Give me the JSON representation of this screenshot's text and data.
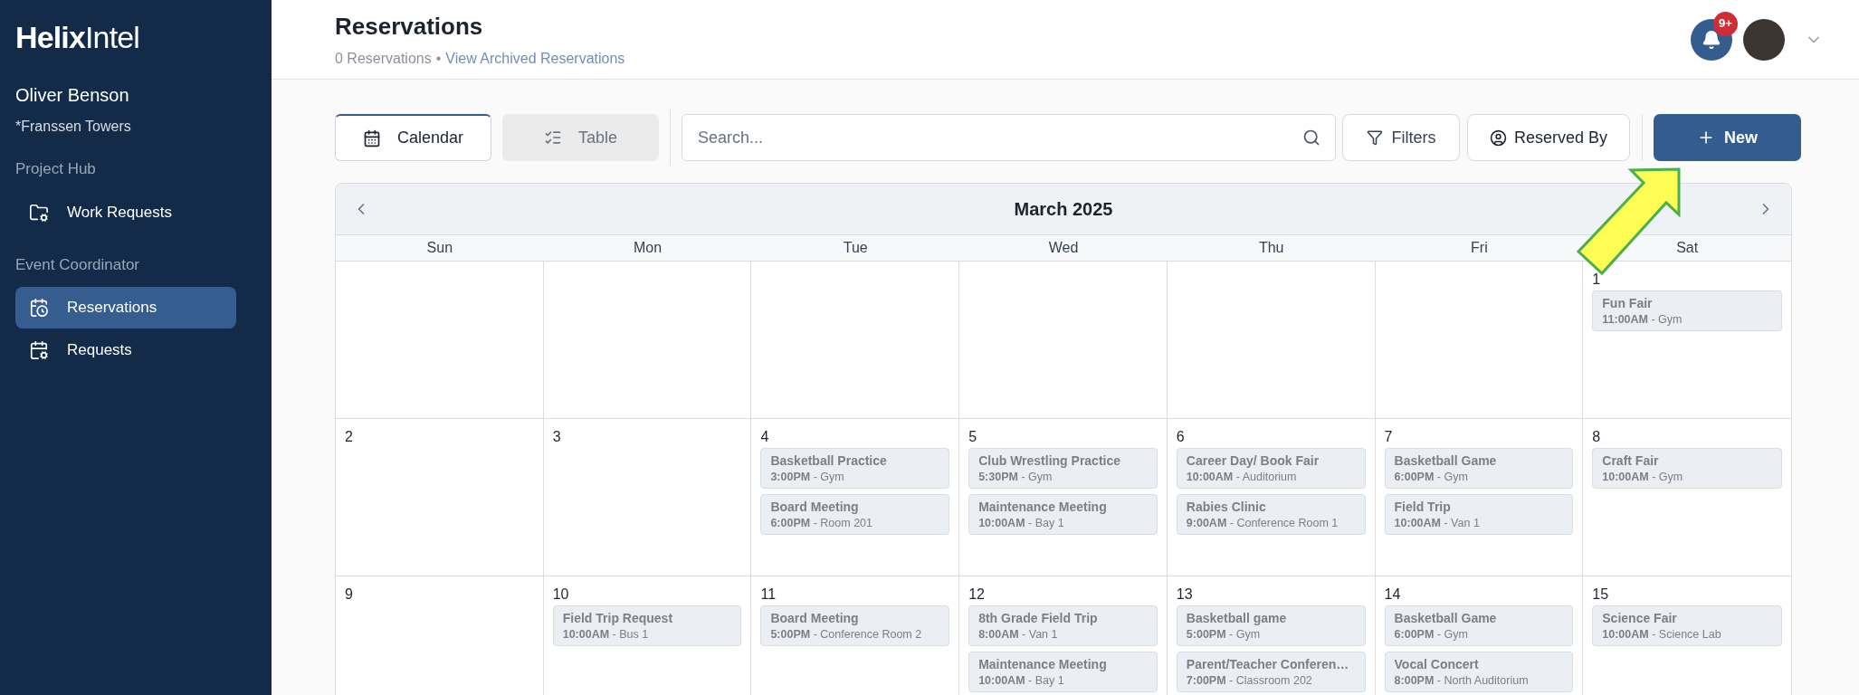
{
  "sidebar": {
    "logo": {
      "bold": "Helix",
      "light": "Intel"
    },
    "user": "Oliver Benson",
    "site": "*Franssen Towers",
    "sections": [
      {
        "heading": "Project Hub",
        "items": [
          {
            "label": "Work Requests",
            "selected": false
          }
        ]
      },
      {
        "heading": "Event Coordinator",
        "items": [
          {
            "label": "Reservations",
            "selected": true
          },
          {
            "label": "Requests",
            "selected": false
          }
        ]
      }
    ]
  },
  "header": {
    "title": "Reservations",
    "count": "0 Reservations",
    "separator": "•",
    "link": "View Archived Reservations",
    "badge": "9+"
  },
  "toolbar": {
    "views": [
      {
        "label": "Calendar",
        "selected": true
      },
      {
        "label": "Table",
        "selected": false
      }
    ],
    "search": {
      "placeholder": "Search..."
    },
    "filters": "Filters",
    "reserved_by": "Reserved By",
    "new": "New"
  },
  "calendar": {
    "month": "March 2025",
    "weekdays": [
      "Sun",
      "Mon",
      "Tue",
      "Wed",
      "Thu",
      "Fri",
      "Sat"
    ],
    "weeks": [
      [
        {
          "date": "1",
          "events": [
            {
              "title": "Fun Fair",
              "when": "**11:00AM** - Gym"
            }
          ]
        }
      ],
      [
        {
          "date": "2"
        },
        {
          "date": "3"
        },
        {
          "date": "4",
          "events": [
            {
              "title": "Basketball Practice",
              "when": "**3:00PM** - Gym"
            },
            {
              "title": "Board Meeting",
              "when": "**6:00PM** - Room 201"
            }
          ]
        },
        {
          "date": "5",
          "events": [
            {
              "title": "Club Wrestling Practice",
              "when": "**5:30PM** - Gym"
            },
            {
              "title": "Maintenance Meeting",
              "when": "**10:00AM** - Bay 1"
            }
          ]
        },
        {
          "date": "6",
          "events": [
            {
              "title": "Career Day/ Book Fair",
              "when": "**10:00AM** - Auditorium"
            },
            {
              "title": "Rabies Clinic",
              "when": "**9:00AM** - Conference Room 1"
            }
          ]
        },
        {
          "date": "7",
          "events": [
            {
              "title": "Basketball Game",
              "when": "**6:00PM** - Gym"
            },
            {
              "title": "Field Trip",
              "when": "**10:00AM** - Van 1"
            }
          ]
        },
        {
          "date": "8",
          "events": [
            {
              "title": "Craft Fair",
              "when": "**10:00AM** - Gym"
            }
          ]
        }
      ],
      [
        {
          "date": "9"
        },
        {
          "date": "10",
          "events": [
            {
              "title": "Field Trip Request",
              "when": "**10:00AM** - Bus 1"
            }
          ]
        },
        {
          "date": "11",
          "events": [
            {
              "title": "Board Meeting",
              "when": "**5:00PM** - Conference Room 2"
            }
          ]
        },
        {
          "date": "12",
          "events": [
            {
              "title": "8th Grade Field Trip",
              "when": "**8:00AM** - Van 1"
            },
            {
              "title": "Maintenance Meeting",
              "when": "**10:00AM** - Bay 1"
            }
          ]
        },
        {
          "date": "13",
          "events": [
            {
              "title": "Basketball game",
              "when": "**5:00PM** - Gym"
            },
            {
              "title": "Parent/Teacher Conferen…",
              "when": "**7:00PM** - Classroom 202"
            }
          ]
        },
        {
          "date": "14",
          "events": [
            {
              "title": "Basketball Game",
              "when": "**6:00PM** - Gym"
            },
            {
              "title": "Vocal Concert",
              "when": "**8:00PM** - North Auditorium"
            }
          ]
        },
        {
          "date": "15",
          "events": [
            {
              "title": "Science Fair",
              "when": "**10:00AM** - Science Lab"
            }
          ]
        }
      ]
    ]
  }
}
